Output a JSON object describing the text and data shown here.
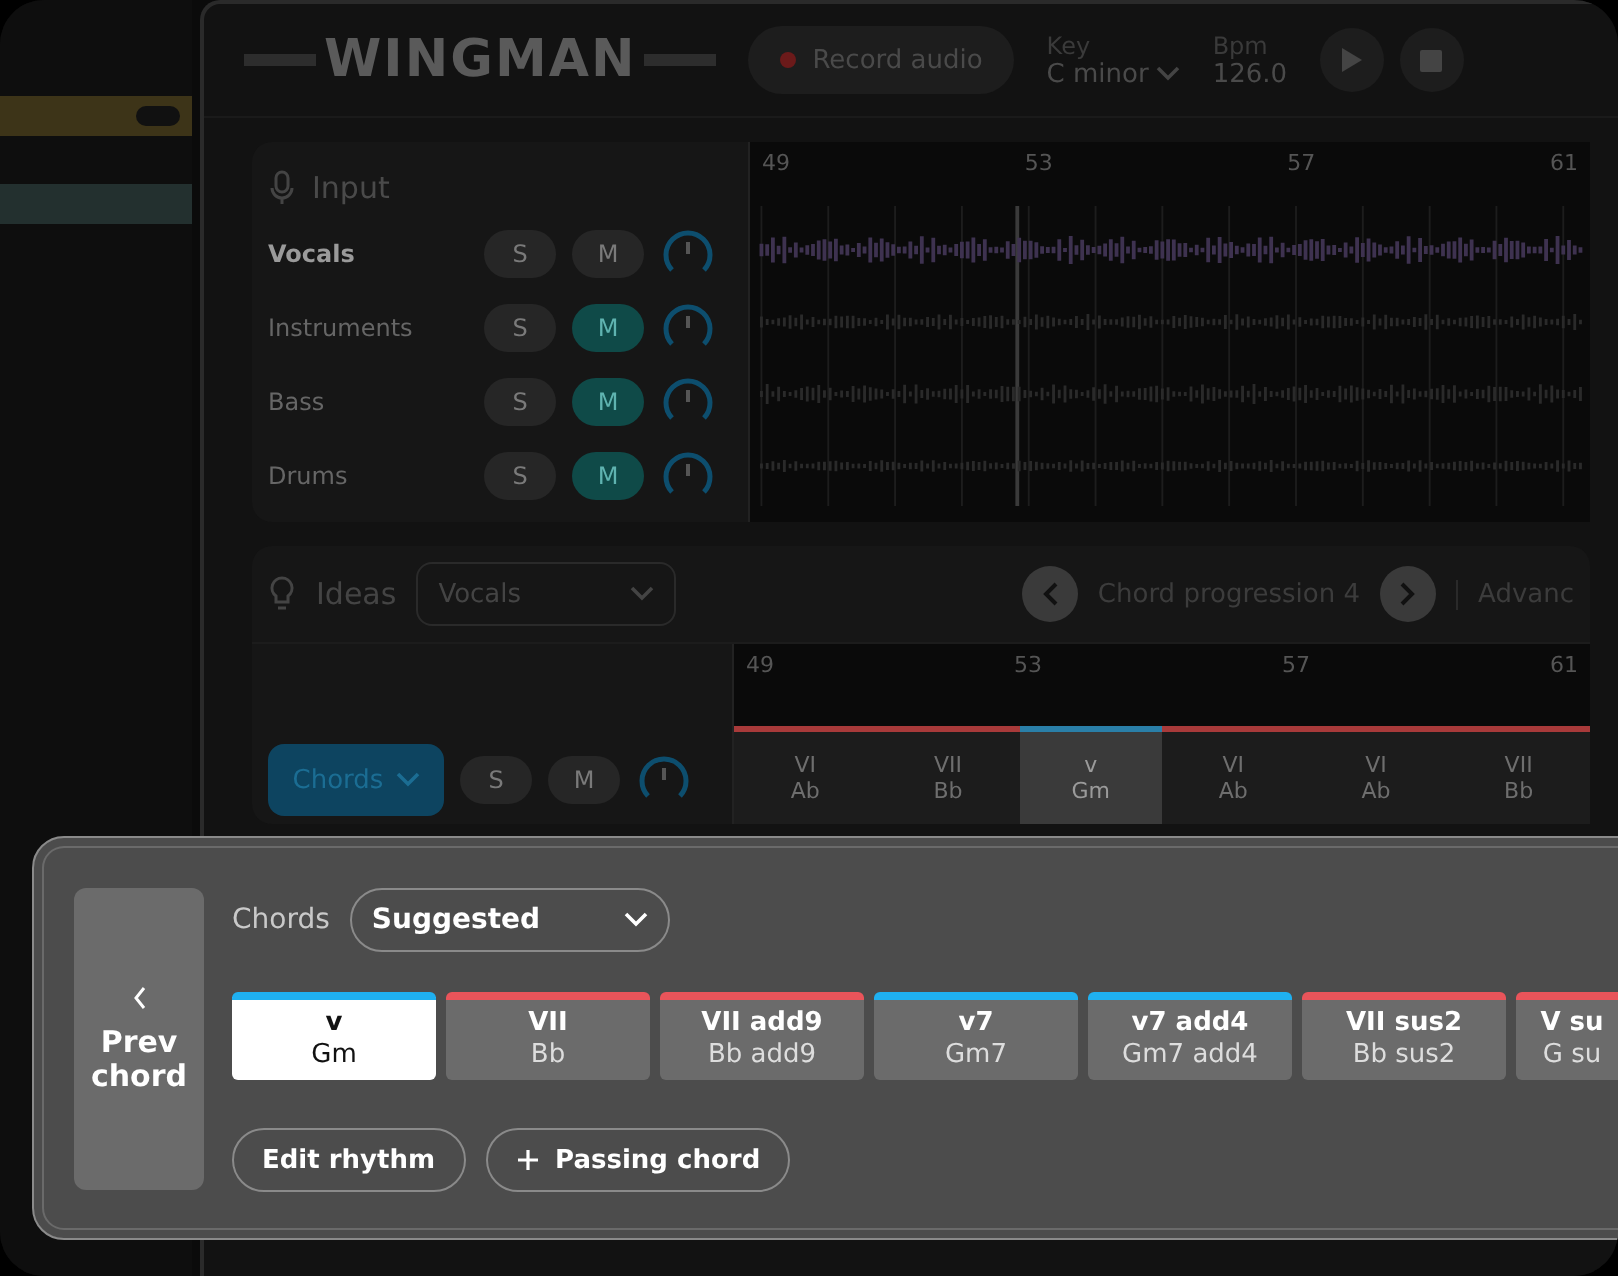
{
  "header": {
    "logo": "WINGMAN",
    "record_button": "Record audio",
    "key": {
      "label": "Key",
      "value": "C minor"
    },
    "bpm": {
      "label": "Bpm",
      "value": "126.0"
    }
  },
  "input": {
    "title": "Input",
    "ruler": [
      "49",
      "53",
      "57",
      "61"
    ],
    "tracks": [
      {
        "name": "Vocals",
        "selected": true,
        "solo": "S",
        "mute": "M",
        "muted": false
      },
      {
        "name": "Instruments",
        "selected": false,
        "solo": "S",
        "mute": "M",
        "muted": true
      },
      {
        "name": "Bass",
        "selected": false,
        "solo": "S",
        "mute": "M",
        "muted": true
      },
      {
        "name": "Drums",
        "selected": false,
        "solo": "S",
        "mute": "M",
        "muted": true
      }
    ]
  },
  "ideas": {
    "title": "Ideas",
    "source": "Vocals",
    "progression": "Chord progression 4",
    "advanced": "Advanc",
    "ruler": [
      "49",
      "53",
      "57",
      "61"
    ],
    "track": {
      "name": "Chords",
      "solo": "S",
      "mute": "M"
    },
    "chords": [
      {
        "numeral": "VI",
        "name": "Ab",
        "selected": false,
        "color": "#a83a3a"
      },
      {
        "numeral": "VII",
        "name": "Bb",
        "selected": false,
        "color": "#a83a3a"
      },
      {
        "numeral": "v",
        "name": "Gm",
        "selected": true,
        "color": "#2a7fa8"
      },
      {
        "numeral": "VI",
        "name": "Ab",
        "selected": false,
        "color": "#a83a3a"
      },
      {
        "numeral": "VI",
        "name": "Ab",
        "selected": false,
        "color": "#a83a3a"
      },
      {
        "numeral": "VII",
        "name": "Bb",
        "selected": false,
        "color": "#a83a3a"
      }
    ]
  },
  "popup": {
    "prev_button": "Prev chord",
    "chords_label": "Chords",
    "filter": "Suggested",
    "options": [
      {
        "numeral": "v",
        "name": "Gm",
        "selected": true,
        "color": "#1fb0f0",
        "clipped": false
      },
      {
        "numeral": "VII",
        "name": "Bb",
        "selected": false,
        "color": "#e9545a",
        "clipped": false
      },
      {
        "numeral": "VII add9",
        "name": "Bb add9",
        "selected": false,
        "color": "#e9545a",
        "clipped": false
      },
      {
        "numeral": "v7",
        "name": "Gm7",
        "selected": false,
        "color": "#1fb0f0",
        "clipped": false
      },
      {
        "numeral": "v7 add4",
        "name": "Gm7 add4",
        "selected": false,
        "color": "#1fb0f0",
        "clipped": false
      },
      {
        "numeral": "VII sus2",
        "name": "Bb sus2",
        "selected": false,
        "color": "#e9545a",
        "clipped": false
      },
      {
        "numeral": "V su",
        "name": "G su",
        "selected": false,
        "color": "#e9545a",
        "clipped": true
      }
    ],
    "edit_rhythm": "Edit rhythm",
    "passing_chord": "Passing chord"
  }
}
